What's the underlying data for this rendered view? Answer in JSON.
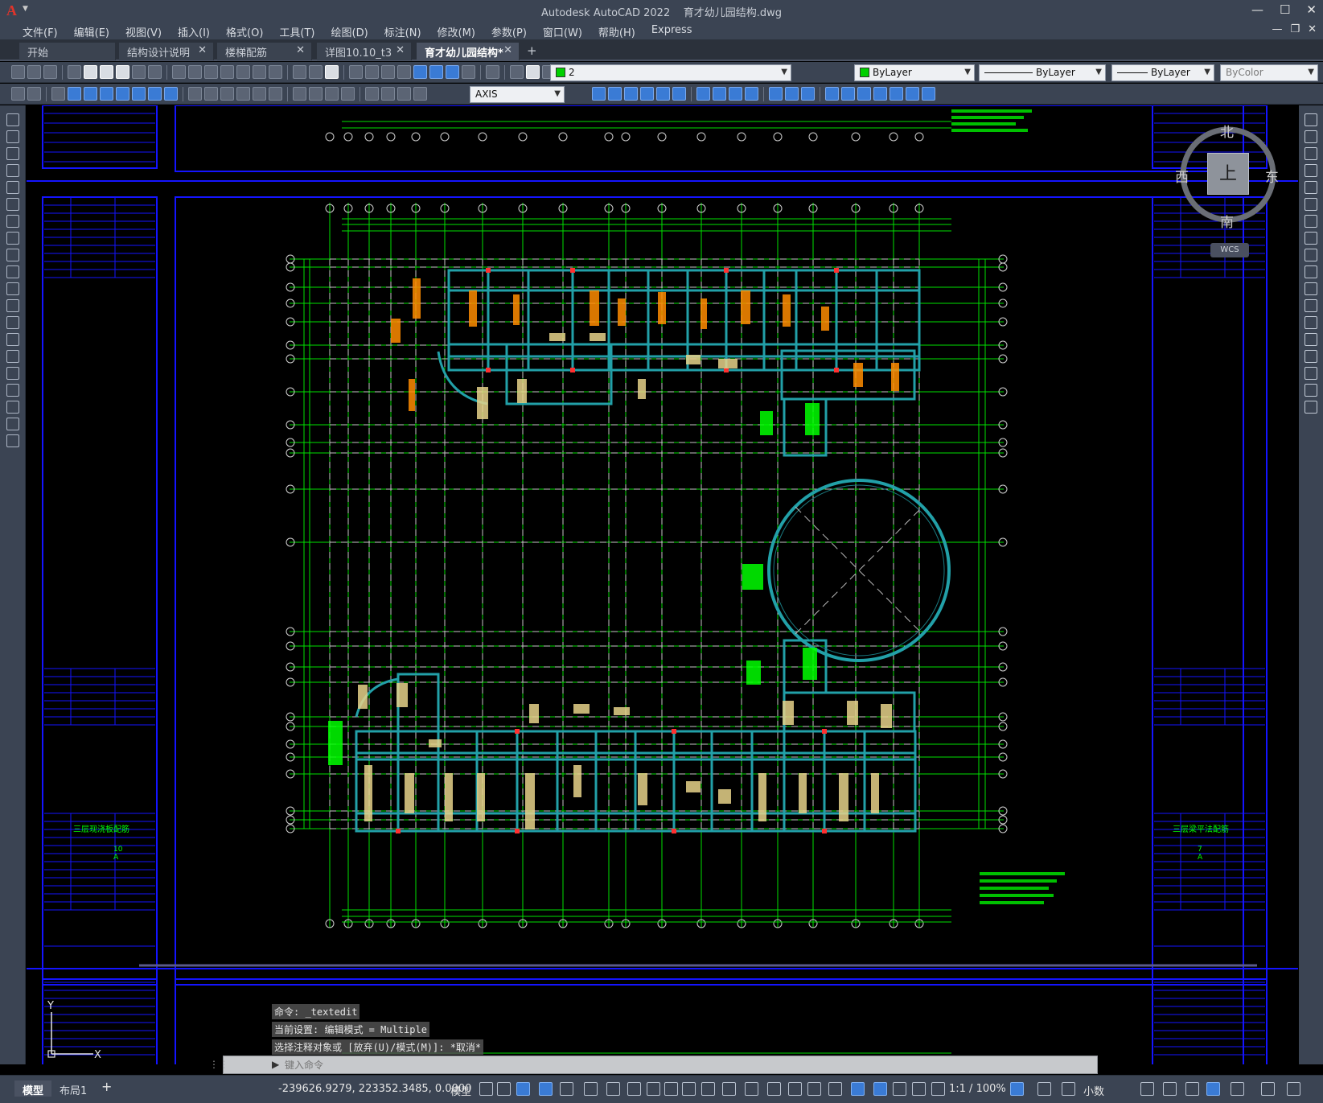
{
  "window": {
    "app_title": "Autodesk AutoCAD 2022",
    "file_name": "育才幼儿园结构.dwg"
  },
  "menu": [
    "文件(F)",
    "编辑(E)",
    "视图(V)",
    "插入(I)",
    "格式(O)",
    "工具(T)",
    "绘图(D)",
    "标注(N)",
    "修改(M)",
    "参数(P)",
    "窗口(W)",
    "帮助(H)",
    "Express"
  ],
  "tabs": [
    {
      "label": "开始",
      "closable": false
    },
    {
      "label": "结构设计说明",
      "closable": true
    },
    {
      "label": "楼梯配筋",
      "closable": true
    },
    {
      "label": "详图10.10_t3",
      "closable": true
    },
    {
      "label": "育才幼儿园结构*",
      "closable": true,
      "active": true
    }
  ],
  "properties": {
    "layer": "2",
    "color": "ByLayer",
    "linetype": "ByLayer",
    "lineweight": "ByLayer",
    "plotstyle": "ByColor",
    "dimstyle": "AXIS",
    "layer_color": "#00d000",
    "color_swatch": "#00d000"
  },
  "viewcube": {
    "north": "北",
    "south": "南",
    "east": "东",
    "west": "西",
    "face": "上",
    "wcs": "WCS"
  },
  "drawing": {
    "sheet_title_1": "三层现浇板配筋",
    "sheet_title_2": "三层梁平法配筋",
    "sheet_no_1": "10",
    "sheet_no_2": "7",
    "rev_1": "A",
    "rev_2": "A"
  },
  "command_history": [
    "命令: _textedit",
    "当前设置: 编辑模式 = Multiple",
    "选择注释对象或 [放弃(U)/模式(M)]: *取消*"
  ],
  "command_input": {
    "placeholder": "键入命令",
    "value": ""
  },
  "ucs": {
    "x": "X",
    "y": "Y"
  },
  "status": {
    "model_tab": "模型",
    "layout_tab": "布局1",
    "coordinates": "-239626.9279, 223352.3485, 0.0000",
    "space": "模型",
    "scale": "1:1 / 100%",
    "units": "小数"
  }
}
